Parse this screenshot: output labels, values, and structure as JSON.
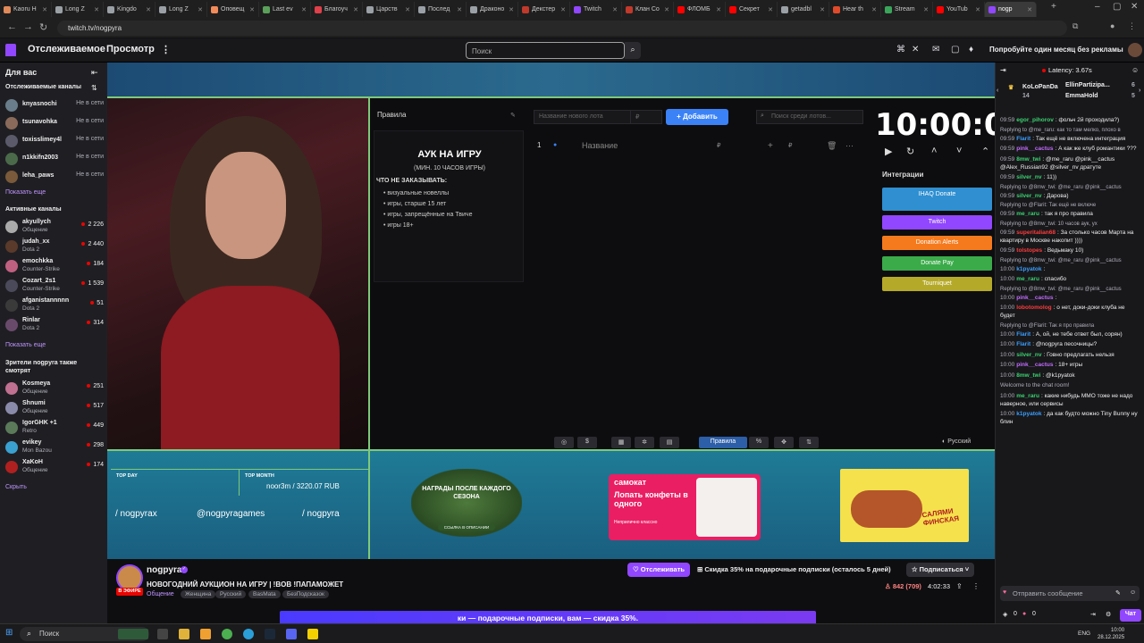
{
  "browser": {
    "tabs": [
      {
        "label": "Kaoru H",
        "color": "#e08a5a"
      },
      {
        "label": "Long Z",
        "color": "#9aa0a6"
      },
      {
        "label": "Kingdo",
        "color": "#9aa0a6"
      },
      {
        "label": "Long Z",
        "color": "#9aa0a6"
      },
      {
        "label": "Оповещ",
        "color": "#f28b5a"
      },
      {
        "label": "Last ev",
        "color": "#5aa05a"
      },
      {
        "label": "Благоуч",
        "color": "#e0404a"
      },
      {
        "label": "Царств",
        "color": "#9aa0a6"
      },
      {
        "label": "Послед",
        "color": "#9aa0a6"
      },
      {
        "label": "Драконо",
        "color": "#9aa0a6"
      },
      {
        "label": "Декстер",
        "color": "#c0392b"
      },
      {
        "label": "Twitch",
        "color": "#9147ff"
      },
      {
        "label": "Клан Со",
        "color": "#c0392b"
      },
      {
        "label": "ФЛОМБ",
        "color": "#ff0000"
      },
      {
        "label": "Секрет",
        "color": "#ff0000"
      },
      {
        "label": "getadbl",
        "color": "#9aa0a6"
      },
      {
        "label": "Hear th",
        "color": "#e04a2a"
      },
      {
        "label": "Stream",
        "color": "#3aa55a"
      },
      {
        "label": "YouTub",
        "color": "#ff0000"
      },
      {
        "label": "nogp",
        "color": "#9147ff",
        "active": true
      }
    ],
    "url": "twitch.tv/nogpyra"
  },
  "topnav": {
    "following": "Отслеживаемое",
    "browse": "Просмотр",
    "more": "⋮",
    "search_placeholder": "Поиск",
    "promo": "Попробуйте один месяц без рекламы"
  },
  "sidebar": {
    "for_you": "Для вас",
    "followed_title": "Отслеживаемые каналы",
    "followed": [
      {
        "name": "knyasnochi",
        "status": "Не в сети",
        "color": "#6a7d8a"
      },
      {
        "name": "tsunavohka",
        "status": "Не в сети",
        "color": "#8a6a5a"
      },
      {
        "name": "toxisslimey4l",
        "status": "Не в сети",
        "color": "#5a5a6a"
      },
      {
        "name": "n1kkifn2003",
        "status": "Не в сети",
        "color": "#4a6a4a"
      },
      {
        "name": "leha_paws",
        "status": "Не в сети",
        "color": "#7a5a3a"
      }
    ],
    "show_more_1": "Показать еще",
    "active_title": "Активные каналы",
    "active": [
      {
        "name": "akyullych",
        "game": "Общение",
        "viewers": "2 226",
        "color": "#aaaaaa"
      },
      {
        "name": "judah_xx",
        "game": "Dota 2",
        "viewers": "2 440",
        "color": "#5a3a2a"
      },
      {
        "name": "emochkka",
        "game": "Counter-Strike",
        "viewers": "184",
        "color": "#c06080"
      },
      {
        "name": "Cozart_2s1",
        "game": "Counter-Strike",
        "viewers": "1 539",
        "color": "#4a4a5a"
      },
      {
        "name": "afganistannnnn",
        "game": "Dota 2",
        "viewers": "51",
        "color": "#3a3a3a"
      },
      {
        "name": "Rinlar",
        "game": "Dota 2",
        "viewers": "314",
        "color": "#6a4a6a"
      }
    ],
    "show_more_2": "Показать еще",
    "viewers_title": "Зрители nogpyra также смотрят",
    "also_watch": [
      {
        "name": "Kosmeya",
        "game": "Общение",
        "viewers": "251",
        "color": "#c07090"
      },
      {
        "name": "Shnumi",
        "game": "Общение",
        "viewers": "517",
        "color": "#8a8aaa"
      },
      {
        "name": "IgorGHK +1",
        "game": "Retro",
        "viewers": "449",
        "color": "#5a7a5a"
      },
      {
        "name": "evikey",
        "game": "Mon Bazou",
        "viewers": "298",
        "color": "#3aa0d0"
      },
      {
        "name": "XaKoH",
        "game": "Общение",
        "viewers": "174",
        "color": "#b02020"
      }
    ],
    "hide": "Скрыть"
  },
  "overlay": {
    "rules_tab": "Правила",
    "rules_title": "АУК НА ИГРУ",
    "rules_subtitle": "(МИН. 10 ЧАСОВ ИГРЫ)",
    "rules_heading": "ЧТО НЕ ЗАКАЗЫВАТЬ:",
    "rules_items": [
      "визуальные новеллы",
      "игры, старше 15 лет",
      "игры, запрещённые на Твиче",
      "игры 18+"
    ],
    "lot_name_placeholder": "Название нового лота",
    "lot_price_placeholder": "₽",
    "add_button": "Добавить",
    "lot_search_placeholder": "Поиск среди лотов...",
    "lot_row_num": "1",
    "lot_row_name": "Название",
    "timer": "10:00:00",
    "integrations_title": "Интеграции",
    "integrations": [
      {
        "label": "IHAQ Donate",
        "color": "#2f8fd1"
      },
      {
        "label": "Twitch",
        "color": "#9147ff"
      },
      {
        "label": "Donation Alerts",
        "color": "#f57a1d"
      },
      {
        "label": "Donate Pay",
        "color": "#3bab4a"
      },
      {
        "label": "Tourniquet",
        "color": "#b5a92a"
      }
    ],
    "toolbar_rules": "Правила",
    "toolbar_lang": "Русский",
    "top_day_label": "TOP DAY",
    "top_month_label": "TOP MONTH",
    "top_month_value": "noor3m / 3220.07 RUB",
    "social_1": "/ nogpyrax",
    "social_2": "@nogpyragames",
    "social_3": "/ nogpyra",
    "season_text": "НАГРАДЫ ПОСЛЕ КАЖДОГО СЕЗОНА",
    "season_sub": "ССЫЛКА В ОПИСАНИИ",
    "samokat_logo": "самокат",
    "samokat_head": "Лопать конфеты в одного",
    "samokat_sub": "Неприлично классно",
    "papa_name": "САЛЯМИ ФИНСКАЯ"
  },
  "stream_info": {
    "channel": "nogpyra",
    "live": "В ЭФИРЕ",
    "title": "НОВОГОДНИЙ АУКЦИОН НА ИГРУ | !BOB !ПАПАМОЖЕТ",
    "category": "Общение",
    "tags": [
      "Женщина",
      "Русский",
      "BasMata",
      "БезПодсказок"
    ],
    "follow": "Отслеживать",
    "gift_promo": "Скидка 35% на подарочные подписки (осталось 5 дней)",
    "subscribe": "Подписаться",
    "viewers": "842 (709)",
    "uptime": "4:02:33",
    "banner": "ки — подарочные подписки, вам — скидка 35%."
  },
  "chat": {
    "latency": "Latency: 3.67s",
    "hype_1_name": "KoLoPanDa",
    "hype_1_val": "14",
    "hype_2_name": "EllinPartizipa...",
    "hype_2_val": "6",
    "hype_3_name": "EmmaHold",
    "hype_3_val": "5",
    "messages": [
      {
        "time": "09:59",
        "user": "egor_pihorov",
        "color": "#3bd16f",
        "text": "фольч 2й проходила?)"
      },
      {
        "reply": "Replying to @me_raru: как то там мелко, плохо в",
        "time": "09:59",
        "user": "Flarit",
        "color": "#3a9fff",
        "text": "Так ещё не включена интеграция"
      },
      {
        "time": "09:59",
        "user": "pink__cactus",
        "color": "#c36bff",
        "text": "А как же клуб романтики ???"
      },
      {
        "time": "09:59",
        "user": "8mw_twi",
        "color": "#3bd16f",
        "text": "@me_raru @pink__cactus @Alex_Russian92 @silver_nv дратуте"
      },
      {
        "time": "09:59",
        "user": "silver_nv",
        "color": "#3bd16f",
        "text": "11))"
      },
      {
        "reply": "Replying to @8mw_twi: @me_raru @pink__cactus",
        "time": "09:59",
        "user": "silver_nv",
        "color": "#3bd16f",
        "text": "Дарова)"
      },
      {
        "reply": "Replying to @Flarit: Так ещё не включе",
        "time": "09:59",
        "user": "me_raru",
        "color": "#3bd16f",
        "text": "так я про правила"
      },
      {
        "reply": "Replying to @8mw_twi: 10 часов аук, ух",
        "time": "09:59",
        "user": "superitalian68",
        "color": "#ff3b3b",
        "text": "За столько часов Марта на квартиру в Москве накопит ))))"
      },
      {
        "time": "09:59",
        "user": "tolstopes",
        "color": "#ff3b3b",
        "text": "Ведьмаку 10)"
      },
      {
        "reply": "Replying to @8mw_twi: @me_raru @pink__cactus",
        "time": "10:00",
        "user": "k1pyatok",
        "color": "#3a9fff",
        "text": ""
      },
      {
        "time": "10:00",
        "user": "me_raru",
        "color": "#3bd16f",
        "text": "спасибо"
      },
      {
        "reply": "Replying to @8mw_twi: @me_raru @pink__cactus",
        "time": "10:00",
        "user": "pink__cactus",
        "color": "#c36bff",
        "text": ""
      },
      {
        "time": "10:00",
        "user": "lobotomolog",
        "color": "#ff3b3b",
        "text": "о нет, доки-доки клуба не будет"
      },
      {
        "reply": "Replying to @Flarit: Так я про правила",
        "time": "10:00",
        "user": "Flarit",
        "color": "#3a9fff",
        "text": "А, ой, не тебе ответ был, сорян)"
      },
      {
        "time": "10:00",
        "user": "Flarit",
        "color": "#3a9fff",
        "text": "@nogpyra песочницы?"
      },
      {
        "time": "10:00",
        "user": "silver_nv",
        "color": "#3bd16f",
        "text": "Говно предлагать нельзя"
      },
      {
        "time": "10:00",
        "user": "pink__cactus",
        "color": "#c36bff",
        "text": "18+ игры"
      },
      {
        "time": "10:00",
        "user": "8mw_twi",
        "color": "#3bd16f",
        "text": "@k1pyatok"
      },
      {
        "system": true,
        "text": "Welcome to the chat room!"
      },
      {
        "time": "10:00",
        "user": "me_raru",
        "color": "#3bd16f",
        "text": "какие нибудь MMO тоже не надо наверное, или сервисы"
      },
      {
        "time": "10:00",
        "user": "k1pyatok",
        "color": "#3a9fff",
        "text": "да как будто можно Tiny Bunny ну блин"
      }
    ],
    "input_placeholder": "Отправить сообщение",
    "points_1": "0",
    "points_2": "0",
    "chat_button": "Чат"
  },
  "taskbar": {
    "search": "Поиск",
    "lang": "ENG",
    "time": "10:00",
    "date": "28.12.2025"
  }
}
